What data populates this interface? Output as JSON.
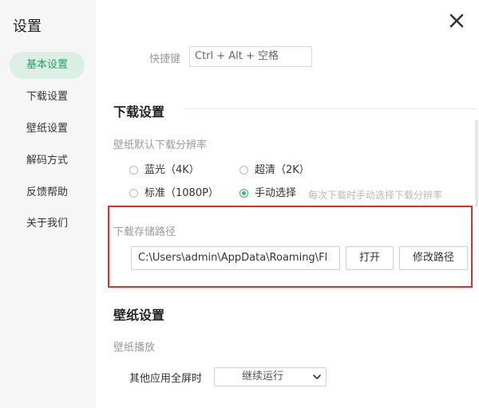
{
  "window": {
    "title": "设置"
  },
  "sidebar": {
    "items": [
      {
        "label": "基本设置",
        "active": true
      },
      {
        "label": "下载设置",
        "active": false
      },
      {
        "label": "壁纸设置",
        "active": false
      },
      {
        "label": "解码方式",
        "active": false
      },
      {
        "label": "反馈帮助",
        "active": false
      },
      {
        "label": "关于我们",
        "active": false
      }
    ]
  },
  "shortcut": {
    "label": "快捷键",
    "value": "Ctrl + Alt + 空格"
  },
  "download": {
    "section_title": "下载设置",
    "resolution_label": "壁纸默认下载分辨率",
    "options": [
      {
        "label": "蓝光（4K）",
        "checked": false
      },
      {
        "label": "超清（2K）",
        "checked": false
      },
      {
        "label": "标准（1080P）",
        "checked": false
      },
      {
        "label": "手动选择",
        "checked": true
      }
    ],
    "manual_hint": "每次下载时手动选择下载分辨率",
    "path_label": "下载存储路径",
    "path_value": "C:\\Users\\admin\\AppData\\Roaming\\Fl",
    "open_button": "打开",
    "change_button": "修改路径"
  },
  "wallpaper": {
    "section_title": "壁纸设置",
    "playback_label": "壁纸播放",
    "fullscreen_label": "其他应用全屏时",
    "fullscreen_value": "继续运行"
  },
  "colors": {
    "accent": "#3cb47d",
    "active_nav_bg": "#dcefe6",
    "highlight_border": "#d9302c"
  },
  "icons": {
    "close": "close-icon",
    "dropdown": "chevron-down-icon"
  }
}
